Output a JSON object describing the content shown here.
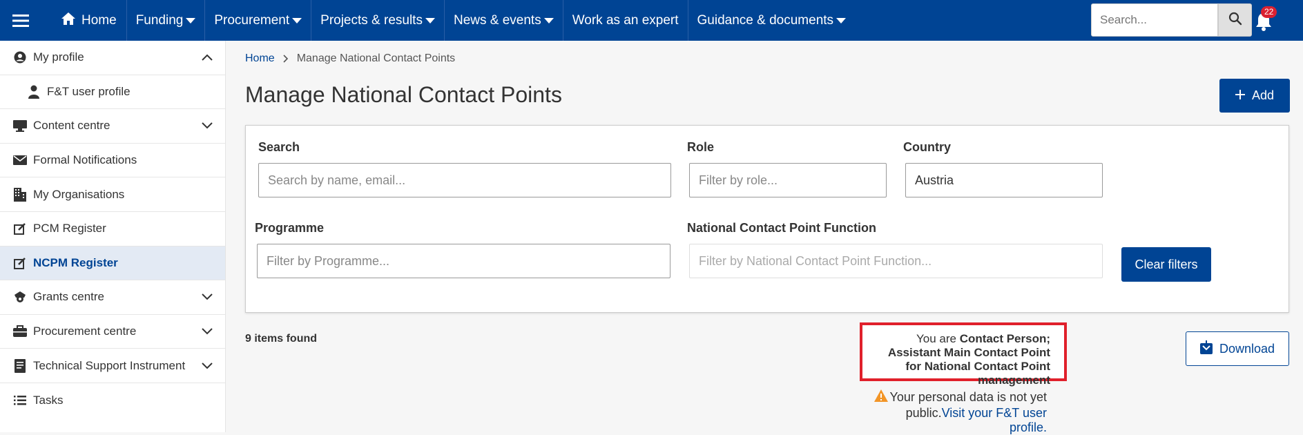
{
  "topnav": {
    "home": "Home",
    "items": [
      {
        "label": "Funding",
        "has_dropdown": true
      },
      {
        "label": "Procurement",
        "has_dropdown": true
      },
      {
        "label": "Projects & results",
        "has_dropdown": true
      },
      {
        "label": "News & events",
        "has_dropdown": true
      },
      {
        "label": "Work as an expert",
        "has_dropdown": false
      },
      {
        "label": "Guidance & documents",
        "has_dropdown": true
      }
    ],
    "search_placeholder": "Search...",
    "notification_count": "22"
  },
  "sidebar": {
    "items": [
      {
        "label": "My profile",
        "icon": "user-circle-icon",
        "chevron": "up"
      },
      {
        "label": "F&T user profile",
        "icon": "person-icon",
        "sub": true
      },
      {
        "label": "Content centre",
        "icon": "monitor-icon",
        "chevron": "down"
      },
      {
        "label": "Formal Notifications",
        "icon": "mail-icon"
      },
      {
        "label": "My Organisations",
        "icon": "building-icon"
      },
      {
        "label": "PCM Register",
        "icon": "edit-icon"
      },
      {
        "label": "NCPM Register",
        "icon": "edit-icon",
        "active": true
      },
      {
        "label": "Grants centre",
        "icon": "grants-icon",
        "chevron": "down"
      },
      {
        "label": "Procurement centre",
        "icon": "briefcase-icon",
        "chevron": "down"
      },
      {
        "label": "Technical Support Instrument",
        "icon": "document-icon",
        "chevron": "down"
      },
      {
        "label": "Tasks",
        "icon": "list-icon"
      }
    ]
  },
  "breadcrumb": {
    "home": "Home",
    "current": "Manage National Contact Points"
  },
  "page": {
    "title": "Manage National Contact Points",
    "add_label": "Add"
  },
  "filters": {
    "search_label": "Search",
    "search_placeholder": "Search by name, email...",
    "role_label": "Role",
    "role_placeholder": "Filter by role...",
    "country_label": "Country",
    "country_value": "Austria",
    "programme_label": "Programme",
    "programme_placeholder": "Filter by Programme...",
    "ncp_function_label": "National Contact Point Function",
    "ncp_function_placeholder": "Filter by National Contact Point Function...",
    "clear_label": "Clear filters"
  },
  "results": {
    "count_text": "9 items found",
    "role_prefix": "You are ",
    "role_text": "Contact Person; Assistant Main Contact Point for National Contact Point management",
    "warning_text": "Your personal data is not yet public.",
    "warning_link": "Visit your F&T user profile.",
    "download_label": "Download"
  },
  "colors": {
    "brand": "#004494",
    "highlight_border": "#e0202b",
    "warning": "#f29527",
    "badge": "#da2131"
  }
}
